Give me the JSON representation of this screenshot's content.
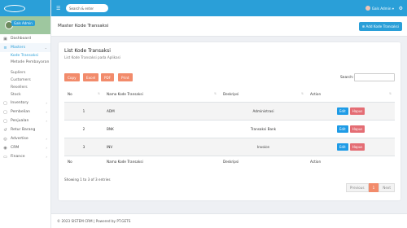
{
  "sidebar": {
    "user_name": "Gals Admin",
    "items": [
      {
        "label": "Dashboard",
        "icon": "dashboard-icon"
      },
      {
        "label": "Masters",
        "icon": "layers-icon"
      },
      {
        "label": "Inventory",
        "icon": "box-icon"
      },
      {
        "label": "Pembelian",
        "icon": "cart-icon"
      },
      {
        "label": "Penjualan",
        "icon": "tag-icon"
      },
      {
        "label": "Retur Barang",
        "icon": "return-icon"
      },
      {
        "label": "Advertise",
        "icon": "megaphone-icon"
      },
      {
        "label": "CRM",
        "icon": "users-icon"
      },
      {
        "label": "Finance",
        "icon": "wallet-icon"
      }
    ],
    "sub_items": [
      "Kode Transaksi",
      "Metode Pembayaran",
      "Supliers",
      "Customers",
      "Resellers",
      "Stock"
    ]
  },
  "topbar": {
    "search_placeholder": "Search & enter",
    "user": "Gals Admin"
  },
  "header": {
    "title": "Master Kode Transaksi",
    "add_button": "Add Kode Transaksi"
  },
  "card": {
    "title": "List Kode Transaksi",
    "subtitle": "List Kode Transaksi pada Aplikasi",
    "exports": [
      "Copy",
      "Excel",
      "PDF",
      "Print"
    ],
    "search_label": "Search:"
  },
  "table": {
    "columns": [
      "No",
      "Nama Kode Transaksi",
      "Deskripsi",
      "Action"
    ],
    "rows": [
      {
        "no": "1",
        "kode": "ADM",
        "deskripsi": "Administrasi"
      },
      {
        "no": "2",
        "kode": "BNK",
        "deskripsi": "Transaksi Bank"
      },
      {
        "no": "3",
        "kode": "INV",
        "deskripsi": "Invoice"
      }
    ],
    "edit_label": "Edit",
    "delete_label": "Hapus"
  },
  "info": "Showing 1 to 3 of 3 entries",
  "pager": {
    "prev": "Previous",
    "current": "1",
    "next": "Next"
  },
  "footer": "© 2023 SISTEM CRM | Powered by PT.GETS",
  "colors": {
    "primary": "#2a9fd8",
    "export": "#f28b6b",
    "edit": "#1e9be6",
    "delete": "#e46d74"
  }
}
